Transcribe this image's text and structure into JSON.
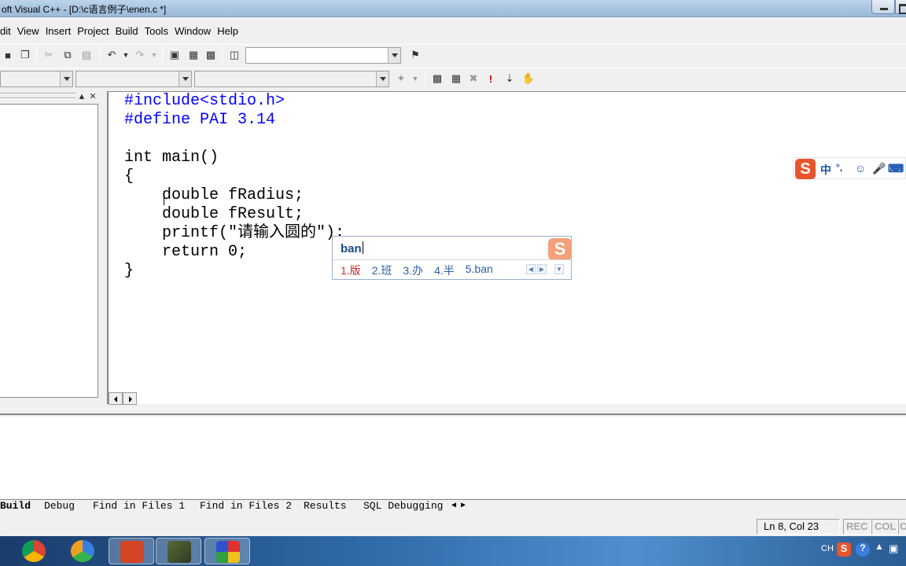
{
  "window": {
    "title": "oft Visual C++ - [D:\\c语言例子\\enen.c *]"
  },
  "menu": [
    "dit",
    "View",
    "Insert",
    "Project",
    "Build",
    "Tools",
    "Window",
    "Help"
  ],
  "code_lines": [
    "#include<stdio.h>",
    "#define PAI 3.14",
    "",
    "int main()",
    "{",
    "    double fRadius;",
    "    double fResult;",
    "    printf(\"请输入圆的\");",
    "    return 0;",
    "}"
  ],
  "ime": {
    "typed": "ban",
    "candidates": [
      "1.版",
      "2.班",
      "3.办",
      "4.半",
      "5.ban"
    ],
    "logo": "S"
  },
  "sogou_bar": {
    "logo": "S",
    "mode": "中",
    "punct": "°,",
    "icons": [
      "smile-icon",
      "mic-icon",
      "keyboard-icon"
    ]
  },
  "output_tabs": [
    "Build",
    "Debug",
    "Find in Files 1",
    "Find in Files 2",
    "Results",
    "SQL Debugging"
  ],
  "status": {
    "position": "Ln 8, Col 23",
    "rec": "REC",
    "col": "COL",
    "ovr": "O"
  },
  "taskbar": {
    "apps": [
      "chrome-icon",
      "sync-icon",
      "powerpoint-icon",
      "recorder-icon",
      "visual-cpp-icon"
    ],
    "tray_lang": "CH"
  },
  "colors": {
    "keyword": "#0000ff",
    "ime_highlight": "#d0282e",
    "ime_text": "#2b5fa8"
  }
}
